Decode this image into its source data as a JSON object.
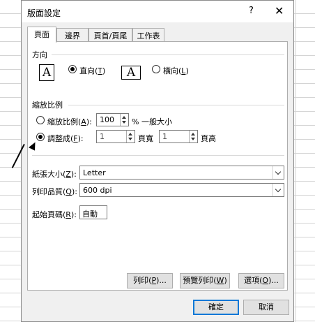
{
  "dialog": {
    "title": "版面設定",
    "help_label": "?",
    "close_label": "✕"
  },
  "tabs": [
    {
      "label": "頁面",
      "active": true
    },
    {
      "label": "邊界",
      "active": false
    },
    {
      "label": "頁首/頁尾",
      "active": false
    },
    {
      "label": "工作表",
      "active": false
    }
  ],
  "orientation": {
    "group_label": "方向",
    "portrait_icon": "A",
    "portrait_label": "直向",
    "portrait_key": "T",
    "landscape_icon": "A",
    "landscape_label": "橫向",
    "landscape_key": "L",
    "selected": "portrait"
  },
  "scaling": {
    "group_label": "縮放比例",
    "adjust_label": "縮放比例",
    "adjust_key": "A",
    "adjust_value": "100",
    "adjust_suffix": "% 一般大小",
    "fit_label": "調整成",
    "fit_key": "F",
    "fit_wide_value": "1",
    "fit_wide_suffix": "頁寬",
    "fit_tall_value": "1",
    "fit_tall_suffix": "頁高",
    "selected": "fit"
  },
  "paper_size": {
    "label": "紙張大小",
    "key": "Z",
    "value": "Letter"
  },
  "print_quality": {
    "label": "列印品質",
    "key": "Q",
    "value": "600 dpi"
  },
  "first_page": {
    "label": "起始頁碼",
    "key": "R",
    "value": "自動"
  },
  "buttons": {
    "print_label": "列印",
    "print_key": "P",
    "preview_label": "預覽列印",
    "preview_key": "W",
    "options_label": "選項",
    "options_key": "O",
    "ok_label": "確定",
    "cancel_label": "取消"
  }
}
